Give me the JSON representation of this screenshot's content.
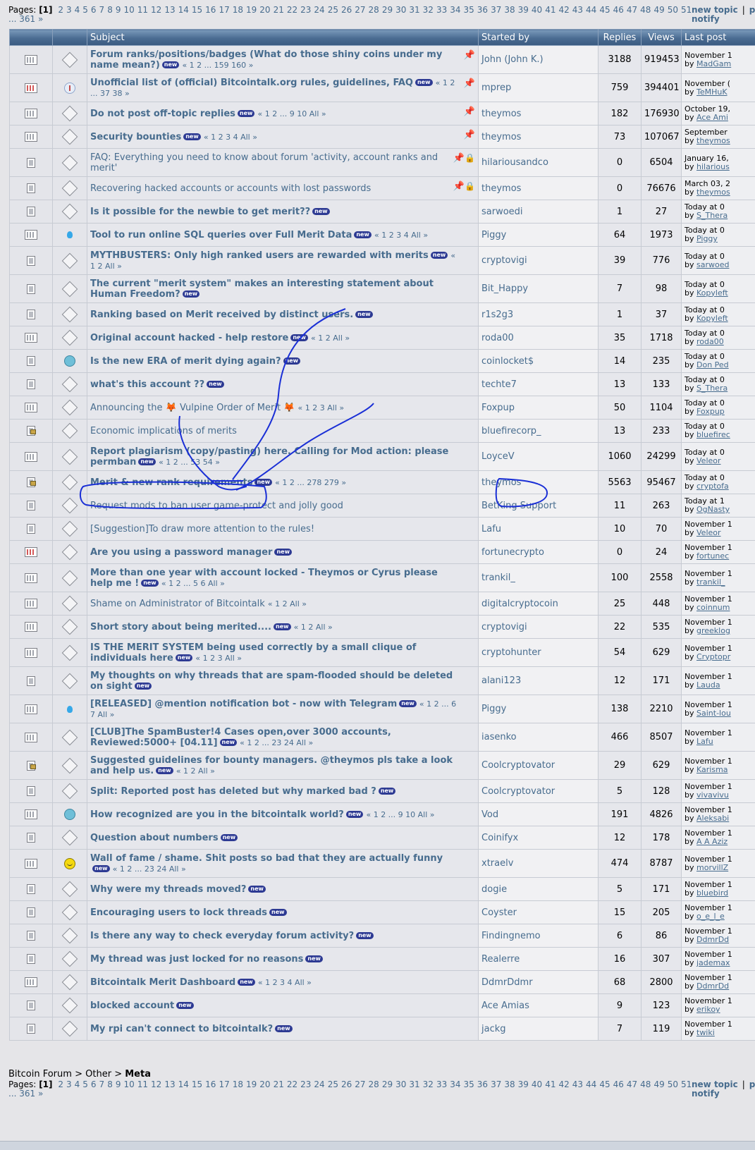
{
  "pages_label": "Pages:",
  "current_page": "[1]",
  "page_numbers": [
    "2",
    "3",
    "4",
    "5",
    "6",
    "7",
    "8",
    "9",
    "10",
    "11",
    "12",
    "13",
    "14",
    "15",
    "16",
    "17",
    "18",
    "19",
    "20",
    "21",
    "22",
    "23",
    "24",
    "25",
    "26",
    "27",
    "28",
    "29",
    "30",
    "31",
    "32",
    "33",
    "34",
    "35",
    "36",
    "37",
    "38",
    "39",
    "40",
    "41",
    "42",
    "43",
    "44",
    "45",
    "46",
    "47",
    "48",
    "49",
    "50",
    "51"
  ],
  "pages_tail": "... 361 »",
  "actions": {
    "new_topic": "new topic",
    "separator": "|",
    "notify": "notify",
    "cut": "po"
  },
  "headers": {
    "subject": "Subject",
    "started_by": "Started by",
    "replies": "Replies",
    "views": "Views",
    "last_post": "Last post"
  },
  "new_badge": "new",
  "topics": [
    {
      "title": "Forum ranks/positions/badges (What do those shiny coins under my name mean?)",
      "bold": true,
      "new": true,
      "pages": "« 1 2 ... 159 160 »",
      "pinned": true,
      "locked": false,
      "starter": "John (John K.)",
      "replies": "3188",
      "views": "919453",
      "lp_date": "November 1",
      "lp_by": "MadGam",
      "icon": "wide",
      "msg": "msg"
    },
    {
      "title": "Unofficial list of (official) Bitcointalk.org rules, guidelines, FAQ",
      "bold": true,
      "new": true,
      "pages": "« 1 2 ... 37 38 »",
      "pinned": true,
      "locked": false,
      "starter": "mprep",
      "replies": "759",
      "views": "394401",
      "lp_date": "November (",
      "lp_by": "TeMHuK",
      "icon": "hot",
      "msg": "info"
    },
    {
      "title": "Do not post off-topic replies",
      "bold": true,
      "new": true,
      "pages": "« 1 2 ... 9 10   All »",
      "pinned": true,
      "locked": false,
      "starter": "theymos",
      "replies": "182",
      "views": "176930",
      "lp_date": "October 19,",
      "lp_by": "Ace Ami",
      "icon": "wide",
      "msg": "msg"
    },
    {
      "title": "Security bounties",
      "bold": true,
      "new": true,
      "pages": "« 1 2 3 4   All »",
      "pinned": true,
      "locked": false,
      "starter": "theymos",
      "replies": "73",
      "views": "107067",
      "lp_date": "September",
      "lp_by": "theymos",
      "icon": "wide",
      "msg": "msg"
    },
    {
      "title": "FAQ: Everything you need to know about forum 'activity, account ranks and merit'",
      "bold": false,
      "new": false,
      "pages": "",
      "pinned": true,
      "locked": true,
      "starter": "hilariousandco",
      "replies": "0",
      "views": "6504",
      "lp_date": "January 16,",
      "lp_by": "hilarious",
      "icon": "thin",
      "msg": "msg"
    },
    {
      "title": "Recovering hacked accounts or accounts with lost passwords",
      "bold": false,
      "new": false,
      "pages": "",
      "pinned": true,
      "locked": true,
      "starter": "theymos",
      "replies": "0",
      "views": "76676",
      "lp_date": "March 03, 2",
      "lp_by": "theymos",
      "icon": "thin",
      "msg": "msg"
    },
    {
      "title": "Is it possible for the newbie to get merit??",
      "bold": true,
      "new": true,
      "pages": "",
      "pinned": false,
      "locked": false,
      "starter": "sarwoedi",
      "replies": "1",
      "views": "27",
      "lp_date": "Today at 0",
      "lp_by": "S_Thera",
      "icon": "thin",
      "msg": "msg"
    },
    {
      "title": "Tool to run online SQL queries over Full Merit Data",
      "bold": true,
      "new": true,
      "pages": "« 1 2 3 4   All »",
      "pinned": false,
      "locked": false,
      "starter": "Piggy",
      "replies": "64",
      "views": "1973",
      "lp_date": "Today at 0",
      "lp_by": "Piggy",
      "icon": "wide",
      "msg": "bulb"
    },
    {
      "title": "MYTHBUSTERS: Only high ranked users are rewarded with merits",
      "bold": true,
      "new": true,
      "pages": "« 1 2   All »",
      "pinned": false,
      "locked": false,
      "starter": "cryptovigi",
      "replies": "39",
      "views": "776",
      "lp_date": "Today at 0",
      "lp_by": "sarwoed",
      "icon": "thin",
      "msg": "msg"
    },
    {
      "title": "The current \"merit system\" makes an interesting statement about Human Freedom?",
      "bold": true,
      "new": true,
      "pages": "",
      "pinned": false,
      "locked": false,
      "starter": "Bit_Happy",
      "replies": "7",
      "views": "98",
      "lp_date": "Today at 0",
      "lp_by": "Kopyleft",
      "icon": "thin",
      "msg": "msg"
    },
    {
      "title": "Ranking based on Merit received by distinct users.",
      "bold": true,
      "new": true,
      "pages": "",
      "pinned": false,
      "locked": false,
      "starter": "r1s2g3",
      "replies": "1",
      "views": "37",
      "lp_date": "Today at 0",
      "lp_by": "Kopyleft",
      "icon": "thin",
      "msg": "msg"
    },
    {
      "title": "Original account hacked - help restore",
      "bold": true,
      "new": true,
      "pages": "« 1 2   All »",
      "pinned": false,
      "locked": false,
      "starter": "roda00",
      "replies": "35",
      "views": "1718",
      "lp_date": "Today at 0",
      "lp_by": "roda00",
      "icon": "wide",
      "msg": "msg"
    },
    {
      "title": "Is the new ERA of merit dying again?",
      "bold": true,
      "new": true,
      "pages": "",
      "pinned": false,
      "locked": false,
      "starter": "coinlocket$",
      "replies": "14",
      "views": "235",
      "lp_date": "Today at 0",
      "lp_by": "Don Ped",
      "icon": "thin",
      "msg": "rec"
    },
    {
      "title": "what's this account ??",
      "bold": true,
      "new": true,
      "pages": "",
      "pinned": false,
      "locked": false,
      "starter": "techte7",
      "replies": "13",
      "views": "133",
      "lp_date": "Today at 0",
      "lp_by": "S_Thera",
      "icon": "thin",
      "msg": "msg"
    },
    {
      "title": "Announcing the 🦊 Vulpine Order of Merit 🦊",
      "bold": false,
      "new": false,
      "pages": "« 1 2 3   All »",
      "pinned": false,
      "locked": false,
      "starter": "Foxpup",
      "replies": "50",
      "views": "1104",
      "lp_date": "Today at 0",
      "lp_by": "Foxpup",
      "icon": "wide",
      "msg": "msg"
    },
    {
      "title": "Economic implications of merits",
      "bold": false,
      "new": false,
      "pages": "",
      "pinned": false,
      "locked": false,
      "starter": "bluefirecorp_",
      "replies": "13",
      "views": "233",
      "lp_date": "Today at 0",
      "lp_by": "bluefirec",
      "icon": "locked",
      "msg": "msg"
    },
    {
      "title": "Report plagiarism (copy/pasting) here. Calling for Mod action: please permban",
      "bold": true,
      "new": true,
      "pages": "« 1 2 ... 53 54 »",
      "pinned": false,
      "locked": false,
      "starter": "LoyceV",
      "replies": "1060",
      "views": "24299",
      "lp_date": "Today at 0",
      "lp_by": "Veleor",
      "icon": "wide",
      "msg": "msg"
    },
    {
      "title": "Merit & new rank requirements",
      "bold": true,
      "new": true,
      "pages": "« 1 2 ... 278 279 »",
      "pinned": false,
      "locked": false,
      "starter": "theymos",
      "replies": "5563",
      "views": "95467",
      "lp_date": "Today at 0",
      "lp_by": "cryptofa",
      "icon": "locked",
      "msg": "msg"
    },
    {
      "title": "Request mods to ban user game-protect and jolly good",
      "bold": false,
      "new": false,
      "pages": "",
      "pinned": false,
      "locked": false,
      "starter": "BetKing Support",
      "replies": "11",
      "views": "263",
      "lp_date": "Today at 1",
      "lp_by": "OgNasty",
      "icon": "thin",
      "msg": "msg"
    },
    {
      "title": "[Suggestion]To draw more attention to the rules!",
      "bold": false,
      "new": false,
      "pages": "",
      "pinned": false,
      "locked": false,
      "starter": "Lafu",
      "replies": "10",
      "views": "70",
      "lp_date": "November 1",
      "lp_by": "Veleor",
      "icon": "thin",
      "msg": "msg"
    },
    {
      "title": "Are you using a password manager",
      "bold": true,
      "new": true,
      "pages": "",
      "pinned": false,
      "locked": false,
      "starter": "fortunecrypto",
      "replies": "0",
      "views": "24",
      "lp_date": "November 1",
      "lp_by": "fortunec",
      "icon": "hot",
      "msg": "msg"
    },
    {
      "title": "More than one year with account locked - Theymos or Cyrus please help me !",
      "bold": true,
      "new": true,
      "pages": "« 1 2 ... 5 6   All »",
      "pinned": false,
      "locked": false,
      "starter": "trankil_",
      "replies": "100",
      "views": "2558",
      "lp_date": "November 1",
      "lp_by": "trankil_",
      "icon": "wide",
      "msg": "msg"
    },
    {
      "title": "Shame on Administrator of Bitcointalk",
      "bold": false,
      "new": false,
      "pages": "« 1 2   All »",
      "pinned": false,
      "locked": false,
      "starter": "digitalcryptocoin",
      "replies": "25",
      "views": "448",
      "lp_date": "November 1",
      "lp_by": "coinnum",
      "icon": "wide",
      "msg": "msg"
    },
    {
      "title": "Short story about being merited....",
      "bold": true,
      "new": true,
      "pages": "« 1 2   All »",
      "pinned": false,
      "locked": false,
      "starter": "cryptovigi",
      "replies": "22",
      "views": "535",
      "lp_date": "November 1",
      "lp_by": "greeklog",
      "icon": "wide",
      "msg": "msg"
    },
    {
      "title": "IS THE MERIT SYSTEM being used correctly by a small clique of individuals here",
      "bold": true,
      "new": true,
      "pages": "« 1 2 3   All »",
      "pinned": false,
      "locked": false,
      "starter": "cryptohunter",
      "replies": "54",
      "views": "629",
      "lp_date": "November 1",
      "lp_by": "Cryptopr",
      "icon": "wide",
      "msg": "msg"
    },
    {
      "title": "My thoughts on why threads that are spam-flooded should be deleted on sight",
      "bold": true,
      "new": true,
      "pages": "",
      "pinned": false,
      "locked": false,
      "starter": "alani123",
      "replies": "12",
      "views": "171",
      "lp_date": "November 1",
      "lp_by": "Lauda",
      "icon": "thin",
      "msg": "msg"
    },
    {
      "title": "[RELEASED] @mention notification bot - now with Telegram",
      "bold": true,
      "new": true,
      "pages": "« 1 2 ... 6 7   All »",
      "pinned": false,
      "locked": false,
      "starter": "Piggy",
      "replies": "138",
      "views": "2210",
      "lp_date": "November 1",
      "lp_by": "Saint-lou",
      "icon": "wide",
      "msg": "bulb"
    },
    {
      "title": "[CLUB]The SpamBuster!4 Cases open,over 3000 accounts, Reviewed:5000+ [04.11]",
      "bold": true,
      "new": true,
      "pages": "« 1 2 ... 23 24   All »",
      "pinned": false,
      "locked": false,
      "starter": "iasenko",
      "replies": "466",
      "views": "8507",
      "lp_date": "November 1",
      "lp_by": "Lafu",
      "icon": "wide",
      "msg": "msg"
    },
    {
      "title": "Suggested guidelines for bounty managers. @theymos pls take a look and help us.",
      "bold": true,
      "new": true,
      "pages": "« 1 2   All »",
      "pinned": false,
      "locked": false,
      "starter": "Coolcryptovator",
      "replies": "29",
      "views": "629",
      "lp_date": "November 1",
      "lp_by": "Karisma",
      "icon": "locked",
      "msg": "msg"
    },
    {
      "title": "Split: Reported post has deleted but why marked bad ?",
      "bold": true,
      "new": true,
      "pages": "",
      "pinned": false,
      "locked": false,
      "starter": "Coolcryptovator",
      "replies": "5",
      "views": "128",
      "lp_date": "November 1",
      "lp_by": "vivavivu",
      "icon": "thin",
      "msg": "msg"
    },
    {
      "title": "How recognized are you in the bitcointalk world?",
      "bold": true,
      "new": true,
      "pages": "« 1 2 ... 9 10   All »",
      "pinned": false,
      "locked": false,
      "starter": "Vod",
      "replies": "191",
      "views": "4826",
      "lp_date": "November 1",
      "lp_by": "Aleksabi",
      "icon": "wide",
      "msg": "rec"
    },
    {
      "title": "Question about numbers",
      "bold": true,
      "new": true,
      "pages": "",
      "pinned": false,
      "locked": false,
      "starter": "Coinifyx",
      "replies": "12",
      "views": "178",
      "lp_date": "November 1",
      "lp_by": "A A Aziz",
      "icon": "thin",
      "msg": "msg"
    },
    {
      "title": "Wall of fame / shame. Shit posts so bad that they are actually funny",
      "bold": true,
      "new": true,
      "pages": "« 1 2 ... 23 24   All »",
      "pinned": false,
      "locked": false,
      "starter": "xtraelv",
      "replies": "474",
      "views": "8787",
      "lp_date": "November 1",
      "lp_by": "morvillZ",
      "icon": "wide",
      "msg": "smile"
    },
    {
      "title": "Why were my threads moved?",
      "bold": true,
      "new": true,
      "pages": "",
      "pinned": false,
      "locked": false,
      "starter": "dogie",
      "replies": "5",
      "views": "171",
      "lp_date": "November 1",
      "lp_by": "bluebird",
      "icon": "thin",
      "msg": "msg"
    },
    {
      "title": "Encouraging users to lock threads",
      "bold": true,
      "new": true,
      "pages": "",
      "pinned": false,
      "locked": false,
      "starter": "Coyster",
      "replies": "15",
      "views": "205",
      "lp_date": "November 1",
      "lp_by": "o_e_l_e",
      "icon": "thin",
      "msg": "msg"
    },
    {
      "title": "Is there any way to check everyday forum activity?",
      "bold": true,
      "new": true,
      "pages": "",
      "pinned": false,
      "locked": false,
      "starter": "Findingnemo",
      "replies": "6",
      "views": "86",
      "lp_date": "November 1",
      "lp_by": "DdmrDd",
      "icon": "thin",
      "msg": "msg"
    },
    {
      "title": "My thread was just locked for no reasons",
      "bold": true,
      "new": true,
      "pages": "",
      "pinned": false,
      "locked": false,
      "starter": "Realerre",
      "replies": "16",
      "views": "307",
      "lp_date": "November 1",
      "lp_by": "jademax",
      "icon": "thin",
      "msg": "msg"
    },
    {
      "title": "Bitcointalk Merit Dashboard",
      "bold": true,
      "new": true,
      "pages": "« 1 2 3 4   All »",
      "pinned": false,
      "locked": false,
      "starter": "DdmrDdmr",
      "replies": "68",
      "views": "2800",
      "lp_date": "November 1",
      "lp_by": "DdmrDd",
      "icon": "wide",
      "msg": "msg"
    },
    {
      "title": "blocked account",
      "bold": true,
      "new": true,
      "pages": "",
      "pinned": false,
      "locked": false,
      "starter": "Ace Amias",
      "replies": "9",
      "views": "123",
      "lp_date": "November 1",
      "lp_by": "erikoy",
      "icon": "thin",
      "msg": "msg"
    },
    {
      "title": "My rpi can't connect to bitcointalk?",
      "bold": true,
      "new": true,
      "pages": "",
      "pinned": false,
      "locked": false,
      "starter": "jackg",
      "replies": "7",
      "views": "119",
      "lp_date": "November 1",
      "lp_by": "twiki",
      "icon": "thin",
      "msg": "msg"
    }
  ],
  "breadcrumb": {
    "root": "Bitcoin Forum",
    "sep": ">",
    "mid": "Other",
    "current": "Meta"
  },
  "annotation_color": "#1a2fd6"
}
